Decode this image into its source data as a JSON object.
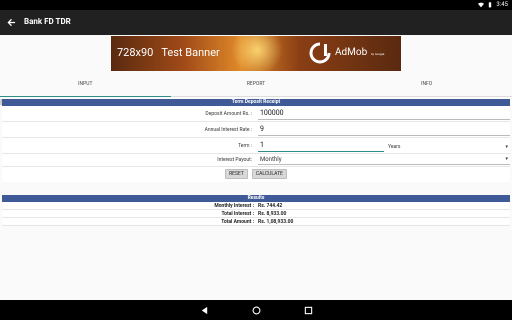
{
  "status_bar": {
    "time": "3:45"
  },
  "toolbar": {
    "title": "Bank FD TDR"
  },
  "banner": {
    "size_text": "728x90",
    "label_text": "Test Banner",
    "admob_text": "AdMob",
    "admob_sub": "by Google",
    "close_text": "x"
  },
  "tabs": [
    {
      "label": "INPUT",
      "active": true
    },
    {
      "label": "REPORT",
      "active": false
    },
    {
      "label": "INFO",
      "active": false
    }
  ],
  "form": {
    "header": "Term Deposit Receipt",
    "deposit_label": "Deposit Amount Rs. :",
    "deposit_value": "100000",
    "rate_label": "Annual Interest Rate :",
    "rate_value": "9",
    "term_label": "Term :",
    "term_value": "1",
    "term_unit": "Years",
    "payout_label": "Interest Payout:",
    "payout_value": "Monthly",
    "reset_label": "RESET",
    "calculate_label": "CALCULATE"
  },
  "results": {
    "header": "Results",
    "rows": [
      {
        "label": "Monthly Interest :",
        "value": "Rs. 744.42"
      },
      {
        "label": "Total Interest :",
        "value": "Rs. 8,933.00"
      },
      {
        "label": "Total Amount :",
        "value": "Rs. 1,08,933.00"
      }
    ]
  },
  "icons": {
    "back": "arrow-left-icon",
    "nav_back": "triangle-back-icon",
    "nav_home": "circle-home-icon",
    "nav_recents": "square-recents-icon"
  },
  "colors": {
    "section_header": "#3f5a96",
    "toolbar": "#212121",
    "accent": "#2f8f88"
  }
}
